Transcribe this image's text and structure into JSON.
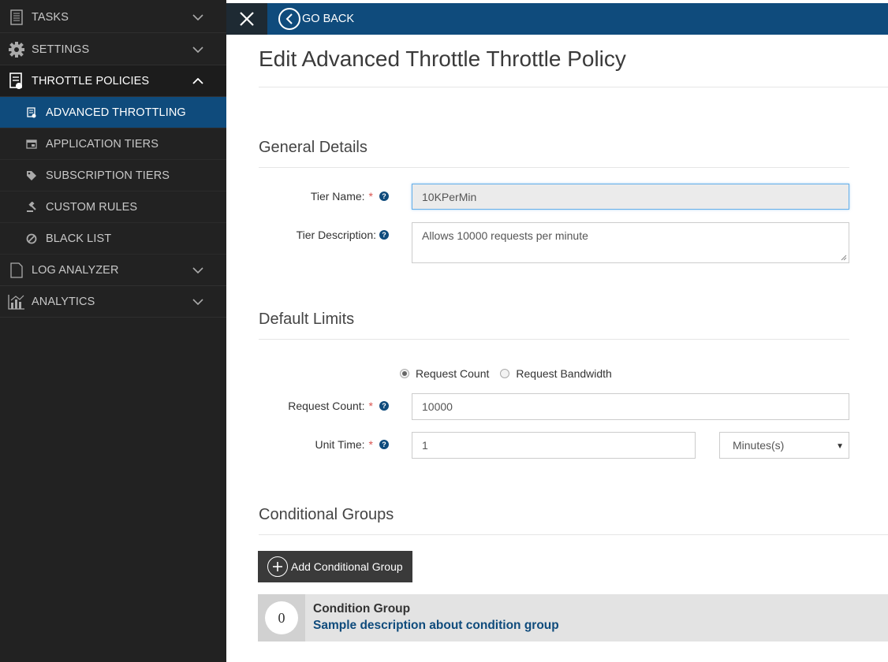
{
  "sidebar": {
    "items": [
      {
        "label": "TASKS",
        "icon": "document-icon"
      },
      {
        "label": "SETTINGS",
        "icon": "gear-icon"
      },
      {
        "label": "THROTTLE POLICIES",
        "icon": "throttle-icon"
      },
      {
        "label": "LOG ANALYZER",
        "icon": "file-icon"
      },
      {
        "label": "ANALYTICS",
        "icon": "chart-icon"
      }
    ],
    "subitems": [
      {
        "label": "ADVANCED THROTTLING",
        "icon": "throttle-doc-icon"
      },
      {
        "label": "APPLICATION TIERS",
        "icon": "window-icon"
      },
      {
        "label": "SUBSCRIPTION TIERS",
        "icon": "tag-icon"
      },
      {
        "label": "CUSTOM RULES",
        "icon": "gavel-icon"
      },
      {
        "label": "BLACK LIST",
        "icon": "ban-icon"
      }
    ]
  },
  "topbar": {
    "back_label": "GO BACK"
  },
  "page": {
    "title": "Edit Advanced Throttle Throttle Policy"
  },
  "general": {
    "title": "General Details",
    "tier_name_label": "Tier Name:",
    "tier_name_value": "10KPerMin",
    "tier_desc_label": "Tier Description:",
    "tier_desc_value": "Allows 10000 requests per minute"
  },
  "limits": {
    "title": "Default Limits",
    "radio_count": "Request Count",
    "radio_bandwidth": "Request Bandwidth",
    "request_count_label": "Request Count:",
    "request_count_value": "10000",
    "unit_time_label": "Unit Time:",
    "unit_time_value": "1",
    "unit_select": "Minutes(s)"
  },
  "conditional": {
    "title": "Conditional Groups",
    "add_label": "Add Conditional Group",
    "group": {
      "number": "0",
      "title": "Condition Group",
      "description": "Sample description about condition group"
    }
  },
  "colors": {
    "sidebar_bg": "#222222",
    "accent": "#0f4b7c",
    "required": "#d9534f"
  }
}
